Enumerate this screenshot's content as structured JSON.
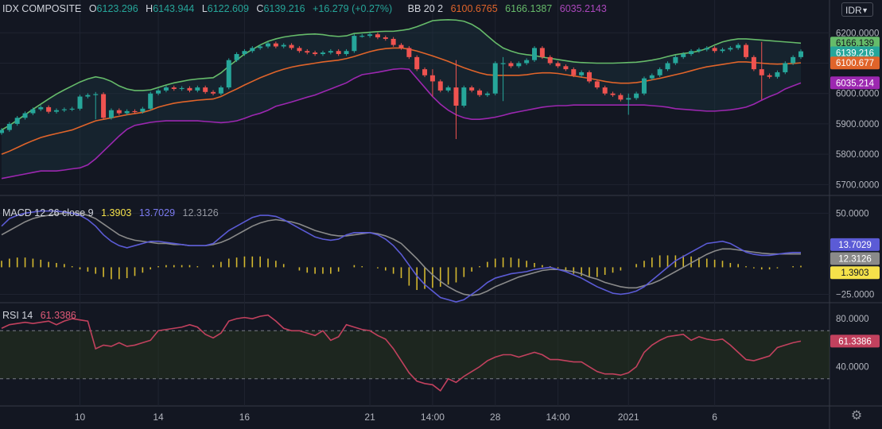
{
  "header": {
    "symbol": "IDX COMPOSITE",
    "ohlc": {
      "o_label": "O",
      "o": "6123.296",
      "h_label": "H",
      "h": "6143.944",
      "l_label": "L",
      "l": "6122.609",
      "c_label": "C",
      "c": "6139.216",
      "change": "+16.279 (+0.27%)"
    },
    "bb_label": "BB 20 2",
    "bb_mid": "6100.6765",
    "bb_upper": "6166.1387",
    "bb_lower": "6035.2143",
    "currency": "IDR"
  },
  "macd_legend": {
    "label": "MACD 12 26 close 9",
    "hist": "1.3903",
    "macd": "13.7029",
    "signal": "12.3126"
  },
  "rsi_legend": {
    "label": "RSI 14",
    "value": "61.3386"
  },
  "price_ticks": [
    "6200.0000",
    "6100.0000",
    "6000.0000",
    "5900.0000",
    "5800.0000",
    "5700.0000"
  ],
  "price_badges": {
    "upper": "6166.139",
    "close": "6139.216",
    "mid": "6100.677",
    "lower": "6035.214"
  },
  "macd_ticks": [
    "50.0000",
    "−25.0000"
  ],
  "macd_badges": {
    "macd": "13.7029",
    "signal": "12.3126",
    "hist": "1.3903"
  },
  "rsi_ticks": [
    "80.0000",
    "40.0000"
  ],
  "rsi_badge": "61.3386",
  "time_ticks": [
    "10",
    "14",
    "16",
    "21",
    "14:00",
    "28",
    "14:00",
    "2021",
    "6"
  ],
  "colors": {
    "bg": "#131722",
    "up": "#26a69a",
    "down": "#ef5350",
    "upper": "#66bb6a",
    "mid": "#e0642a",
    "lower": "#9c27b0",
    "macd": "#5b5bd6",
    "signal": "#8a8a8a",
    "hist": "#d4b82f",
    "rsi": "#c2415e"
  },
  "chart_data": [
    {
      "type": "candlestick",
      "ylim": [
        5680,
        6240
      ],
      "close": [
        5880,
        5900,
        5920,
        5935,
        5948,
        5955,
        5940,
        5945,
        5948,
        5950,
        5990,
        5995,
        5998,
        5920,
        5945,
        5935,
        5942,
        5940,
        5950,
        6000,
        6010,
        6020,
        6015,
        6018,
        6010,
        6020,
        6005,
        6000,
        6020,
        6110,
        6130,
        6140,
        6150,
        6155,
        6165,
        6155,
        6160,
        6150,
        6140,
        6135,
        6130,
        6135,
        6140,
        6130,
        6140,
        6190,
        6190,
        6195,
        6185,
        6180,
        6160,
        6150,
        6120,
        6080,
        6060,
        6040,
        6010,
        6020,
        5960,
        6020,
        6010,
        5995,
        6000,
        6100,
        6100,
        6090,
        6100,
        6110,
        6150,
        6120,
        6100,
        6090,
        6080,
        6060,
        6070,
        6040,
        6020,
        6000,
        5995,
        5980,
        5985,
        6000,
        6050,
        6060,
        6080,
        6100,
        6120,
        6130,
        6140,
        6145,
        6150,
        6140,
        6145,
        6150,
        6160,
        6120,
        6080,
        6060,
        6055,
        6070,
        6100,
        6120,
        6139
      ],
      "bb_upper": [
        5880,
        5895,
        5912,
        5930,
        5948,
        5965,
        5982,
        5998,
        6012,
        6025,
        6038,
        6048,
        6055,
        6050,
        6040,
        6025,
        6015,
        6010,
        6010,
        6012,
        6020,
        6028,
        6035,
        6040,
        6045,
        6048,
        6050,
        6052,
        6068,
        6090,
        6110,
        6130,
        6145,
        6160,
        6172,
        6180,
        6186,
        6190,
        6193,
        6195,
        6196,
        6194,
        6190,
        6188,
        6190,
        6198,
        6200,
        6202,
        6204,
        6205,
        6205,
        6208,
        6212,
        6220,
        6230,
        6240,
        6242,
        6243,
        6242,
        6238,
        6228,
        6212,
        6190,
        6168,
        6150,
        6140,
        6132,
        6128,
        6125,
        6120,
        6116,
        6112,
        6108,
        6104,
        6102,
        6101,
        6100,
        6100,
        6100,
        6101,
        6102,
        6103,
        6106,
        6110,
        6115,
        6122,
        6128,
        6132,
        6135,
        6140,
        6148,
        6160,
        6170,
        6176,
        6180,
        6180,
        6178,
        6176,
        6174,
        6172,
        6170,
        6168,
        6166
      ],
      "bb_mid": [
        5800,
        5810,
        5822,
        5834,
        5845,
        5855,
        5862,
        5868,
        5874,
        5880,
        5890,
        5900,
        5910,
        5915,
        5920,
        5925,
        5930,
        5934,
        5938,
        5945,
        5955,
        5962,
        5968,
        5972,
        5975,
        5978,
        5980,
        5982,
        5990,
        6003,
        6015,
        6028,
        6040,
        6052,
        6062,
        6072,
        6080,
        6087,
        6092,
        6096,
        6100,
        6104,
        6107,
        6110,
        6115,
        6122,
        6130,
        6138,
        6144,
        6148,
        6150,
        6150,
        6146,
        6140,
        6132,
        6124,
        6115,
        6106,
        6095,
        6085,
        6076,
        6068,
        6062,
        6060,
        6060,
        6060,
        6060,
        6062,
        6066,
        6068,
        6068,
        6066,
        6062,
        6058,
        6054,
        6050,
        6045,
        6040,
        6036,
        6034,
        6034,
        6036,
        6040,
        6045,
        6050,
        6056,
        6062,
        6068,
        6075,
        6082,
        6088,
        6092,
        6096,
        6100,
        6104,
        6104,
        6102,
        6100,
        6098,
        6097,
        6098,
        6099,
        6101
      ],
      "bb_lower": [
        5720,
        5725,
        5730,
        5735,
        5740,
        5745,
        5745,
        5745,
        5748,
        5752,
        5755,
        5765,
        5785,
        5810,
        5835,
        5860,
        5882,
        5895,
        5900,
        5905,
        5908,
        5910,
        5910,
        5910,
        5910,
        5910,
        5908,
        5906,
        5904,
        5906,
        5910,
        5918,
        5928,
        5935,
        5945,
        5958,
        5965,
        5972,
        5980,
        5988,
        5995,
        6005,
        6015,
        6025,
        6035,
        6050,
        6062,
        6066,
        6070,
        6075,
        6080,
        6082,
        6080,
        6050,
        6020,
        5990,
        5965,
        5945,
        5930,
        5920,
        5915,
        5915,
        5918,
        5922,
        5928,
        5935,
        5940,
        5945,
        5950,
        5955,
        5958,
        5960,
        5960,
        5962,
        5962,
        5962,
        5962,
        5962,
        5962,
        5962,
        5962,
        5962,
        5962,
        5960,
        5958,
        5955,
        5950,
        5948,
        5946,
        5944,
        5942,
        5942,
        5944,
        5946,
        5950,
        5955,
        5965,
        5978,
        5990,
        6000,
        6015,
        6025,
        6035
      ]
    },
    {
      "type": "line",
      "ylim": [
        -32,
        62
      ],
      "macd": [
        38,
        45,
        48,
        50,
        51,
        52,
        52,
        52,
        51,
        50,
        48,
        44,
        38,
        30,
        24,
        20,
        18,
        20,
        22,
        24,
        24,
        23,
        22,
        21,
        20,
        20,
        20,
        22,
        28,
        34,
        38,
        42,
        46,
        48,
        48,
        47,
        44,
        40,
        36,
        32,
        28,
        26,
        25,
        26,
        30,
        32,
        32,
        32,
        30,
        26,
        20,
        12,
        2,
        -8,
        -16,
        -22,
        -28,
        -30,
        -32,
        -30,
        -25,
        -20,
        -14,
        -10,
        -8,
        -6,
        -5,
        -4,
        -2,
        -1,
        0,
        -2,
        -4,
        -7,
        -10,
        -14,
        -18,
        -21,
        -24,
        -25,
        -24,
        -22,
        -18,
        -12,
        -6,
        0,
        6,
        10,
        14,
        18,
        22,
        23,
        24,
        22,
        18,
        14,
        12,
        11,
        11,
        12,
        13,
        13.7,
        13.7
      ],
      "signal": [
        30,
        34,
        38,
        42,
        45,
        47,
        48,
        49,
        50,
        50,
        50,
        48,
        45,
        40,
        35,
        30,
        27,
        25,
        24,
        23,
        22,
        22,
        21,
        21,
        20,
        20,
        20,
        21,
        23,
        26,
        30,
        34,
        38,
        41,
        43,
        44,
        43,
        42,
        40,
        37,
        34,
        32,
        30,
        29,
        29,
        30,
        31,
        32,
        31,
        29,
        26,
        22,
        15,
        8,
        0,
        -7,
        -13,
        -18,
        -22,
        -25,
        -26,
        -25,
        -22,
        -18,
        -15,
        -12,
        -9,
        -7,
        -5,
        -3,
        -2,
        -2,
        -3,
        -4,
        -6,
        -9,
        -11,
        -14,
        -16,
        -18,
        -19,
        -19,
        -17,
        -15,
        -12,
        -8,
        -4,
        0,
        4,
        8,
        12,
        15,
        17,
        17,
        16,
        15,
        14,
        13,
        12.5,
        12.3,
        12.3,
        12.3,
        12.3
      ],
      "hist": [
        6,
        8,
        9,
        9,
        8,
        7,
        5,
        4,
        3,
        1,
        -2,
        -4,
        -6,
        -9,
        -11,
        -11,
        -10,
        -8,
        -5,
        -2,
        1,
        2,
        2,
        2,
        2,
        1,
        0,
        2,
        5,
        8,
        9,
        10,
        10,
        10,
        8,
        6,
        3,
        0,
        -3,
        -5,
        -6,
        -6,
        -6,
        -4,
        0,
        2,
        1,
        0,
        -1,
        -3,
        -6,
        -10,
        -17,
        -21,
        -20,
        -19,
        -18,
        -16,
        -14,
        -9,
        -4,
        1,
        5,
        8,
        9,
        9,
        8,
        6,
        4,
        2,
        1,
        -1,
        -3,
        -6,
        -8,
        -9,
        -9,
        -7,
        -5,
        -3,
        0,
        3,
        6,
        9,
        11,
        11,
        11,
        11,
        10,
        9,
        8,
        7,
        6,
        4,
        3,
        1,
        -1,
        -2,
        -2,
        -1,
        0,
        1,
        1.4
      ]
    },
    {
      "type": "line",
      "ylim": [
        10,
        92
      ],
      "reference_lines": [
        70,
        30
      ],
      "rsi": [
        72,
        75,
        76,
        77,
        76,
        77,
        78,
        75,
        78,
        80,
        79,
        78,
        55,
        58,
        57,
        60,
        57,
        58,
        60,
        62,
        70,
        71,
        72,
        73,
        75,
        73,
        67,
        64,
        68,
        78,
        80,
        81,
        80,
        82,
        83,
        78,
        72,
        70,
        70,
        68,
        66,
        70,
        62,
        65,
        75,
        73,
        71,
        70,
        66,
        63,
        55,
        45,
        35,
        28,
        26,
        25,
        20,
        30,
        27,
        32,
        36,
        40,
        45,
        48,
        50,
        50,
        48,
        50,
        52,
        50,
        46,
        46,
        45,
        44,
        44,
        40,
        36,
        34,
        34,
        33,
        35,
        40,
        52,
        58,
        62,
        65,
        66,
        67,
        62,
        65,
        63,
        62,
        63,
        58,
        52,
        46,
        45,
        47,
        49,
        56,
        58,
        60,
        61.34
      ]
    }
  ]
}
